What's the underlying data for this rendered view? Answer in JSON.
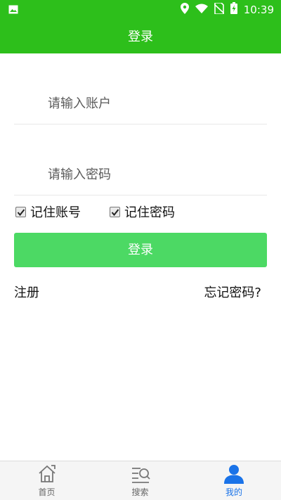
{
  "status_bar": {
    "time": "10:39"
  },
  "header": {
    "title": "登录"
  },
  "form": {
    "account_placeholder": "请输入账户",
    "password_placeholder": "请输入密码",
    "remember_account": {
      "label": "记住账号",
      "checked": true
    },
    "remember_password": {
      "label": "记住密码",
      "checked": true
    },
    "login_button": "登录",
    "register_link": "注册",
    "forgot_link": "忘记密码?"
  },
  "tabs": [
    {
      "label": "首页",
      "icon": "home-icon",
      "active": false
    },
    {
      "label": "搜索",
      "icon": "search-list-icon",
      "active": false
    },
    {
      "label": "我的",
      "icon": "user-icon",
      "active": true
    }
  ],
  "colors": {
    "header": "#2dbf1b",
    "button": "#4cd964",
    "active_tab": "#1a73e8"
  }
}
